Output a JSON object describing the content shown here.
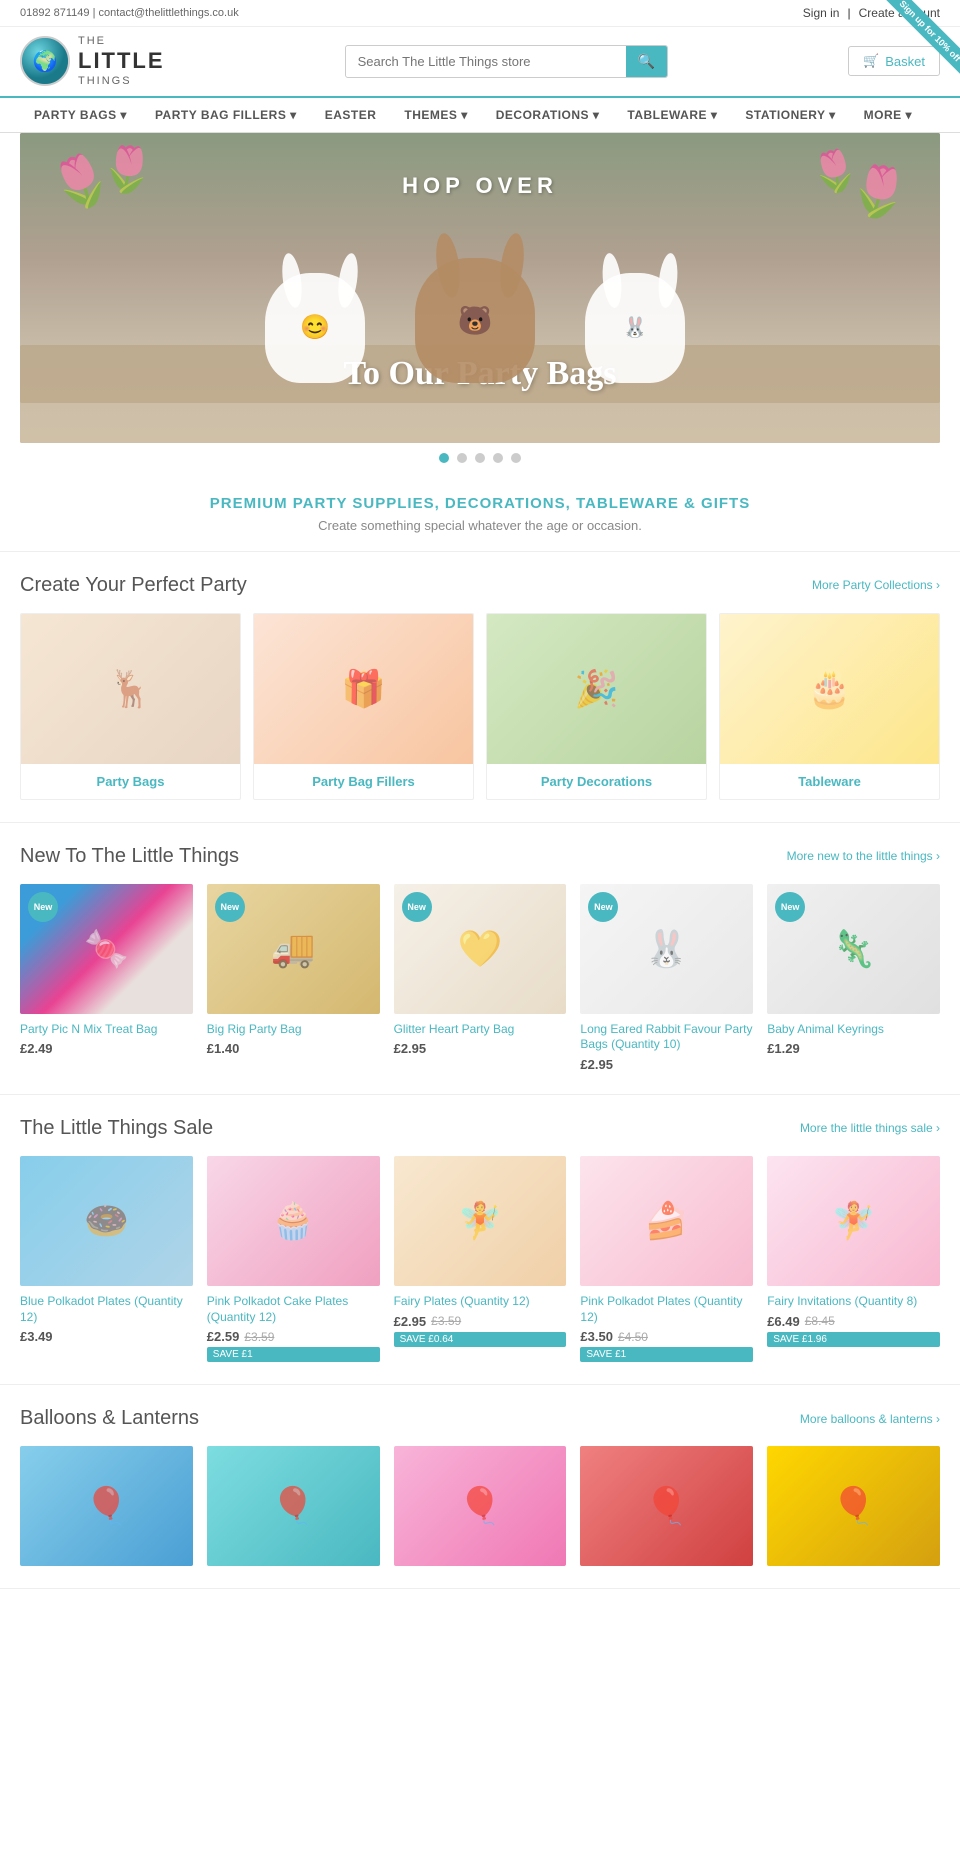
{
  "topbar": {
    "phone": "01892 871149",
    "email": "contact@thelittlethings.co.uk",
    "sign_in": "Sign in",
    "create_account": "Create account",
    "separator": "|"
  },
  "header": {
    "logo_line1": "THE",
    "logo_line2": "LITTLE",
    "logo_line3": "THINGS",
    "search_placeholder": "Search The Little Things store",
    "basket_label": "Basket",
    "promo_text": "Sign up for 10% off"
  },
  "nav": {
    "items": [
      {
        "label": "PARTY BAGS",
        "has_dropdown": true
      },
      {
        "label": "PARTY BAG FILLERS",
        "has_dropdown": true
      },
      {
        "label": "EASTER",
        "has_dropdown": false
      },
      {
        "label": "THEMES",
        "has_dropdown": true
      },
      {
        "label": "DECORATIONS",
        "has_dropdown": true
      },
      {
        "label": "TABLEWARE",
        "has_dropdown": true
      },
      {
        "label": "STATIONERY",
        "has_dropdown": true
      },
      {
        "label": "MORE",
        "has_dropdown": true
      }
    ]
  },
  "hero": {
    "top_text": "HOP OVER",
    "bottom_text": "To Our Party Bags",
    "dots": 5,
    "active_dot": 0
  },
  "tagline": {
    "heading": "PREMIUM PARTY SUPPLIES, DECORATIONS, TABLEWARE & GIFTS",
    "subheading": "Create something special whatever the age or occasion."
  },
  "party_section": {
    "title": "Create Your Perfect Party",
    "more_link": "More Party Collections ›",
    "items": [
      {
        "label": "Party Bags",
        "thumb_class": "collection-thumb-1"
      },
      {
        "label": "Party Bag Fillers",
        "thumb_class": "collection-thumb-2"
      },
      {
        "label": "Party Decorations",
        "thumb_class": "collection-thumb-3"
      },
      {
        "label": "Tableware",
        "thumb_class": "collection-thumb-4"
      }
    ]
  },
  "new_section": {
    "title": "New To The Little Things",
    "more_link": "More new to the little things ›",
    "items": [
      {
        "name": "Party Pic N Mix Treat Bag",
        "price": "£2.49",
        "badge": "New",
        "thumb_class": "thumb-party-pic"
      },
      {
        "name": "Big Rig Party Bag",
        "price": "£1.40",
        "badge": "New",
        "thumb_class": "thumb-big-rig"
      },
      {
        "name": "Glitter Heart Party Bag",
        "price": "£2.95",
        "badge": "New",
        "thumb_class": "thumb-glitter"
      },
      {
        "name": "Long Eared Rabbit Favour Party Bags (Quantity 10)",
        "price": "£2.95",
        "badge": "New",
        "thumb_class": "thumb-rabbit"
      },
      {
        "name": "Baby Animal Keyrings",
        "price": "£1.29",
        "badge": "New",
        "thumb_class": "thumb-keyrings"
      }
    ]
  },
  "sale_section": {
    "title": "The Little Things Sale",
    "more_link": "More the little things sale ›",
    "items": [
      {
        "name": "Blue Polkadot Plates (Quantity 12)",
        "price_new": "£3.49",
        "price_old": "",
        "save": "",
        "thumb_class": "thumb-blue-plates"
      },
      {
        "name": "Pink Polkadot Cake Plates (Quantity 12)",
        "price_new": "£2.59",
        "price_old": "£3.59",
        "save": "SAVE £1",
        "thumb_class": "thumb-pink-cake"
      },
      {
        "name": "Fairy Plates (Quantity 12)",
        "price_new": "£2.95",
        "price_old": "£3.59",
        "save": "SAVE £0.64",
        "thumb_class": "thumb-fairy-plates"
      },
      {
        "name": "Pink Polkadot Plates (Quantity 12)",
        "price_new": "£3.50",
        "price_old": "£4.50",
        "save": "SAVE £1",
        "thumb_class": "thumb-pink-plates"
      },
      {
        "name": "Fairy Invitations (Quantity 8)",
        "price_new": "£6.49",
        "price_old": "£8.45",
        "save": "SAVE £1.96",
        "thumb_class": "thumb-fairy-inv"
      }
    ]
  },
  "balloons_section": {
    "title": "Balloons & Lanterns",
    "more_link": "More balloons & lanterns ›",
    "items": [
      {
        "thumb_class": "thumb-blue-balloons"
      },
      {
        "thumb_class": "thumb-aqua-balloons"
      },
      {
        "thumb_class": "thumb-pink-balloons"
      },
      {
        "thumb_class": "thumb-red-balloons"
      },
      {
        "thumb_class": "thumb-gold-balloons"
      }
    ]
  }
}
